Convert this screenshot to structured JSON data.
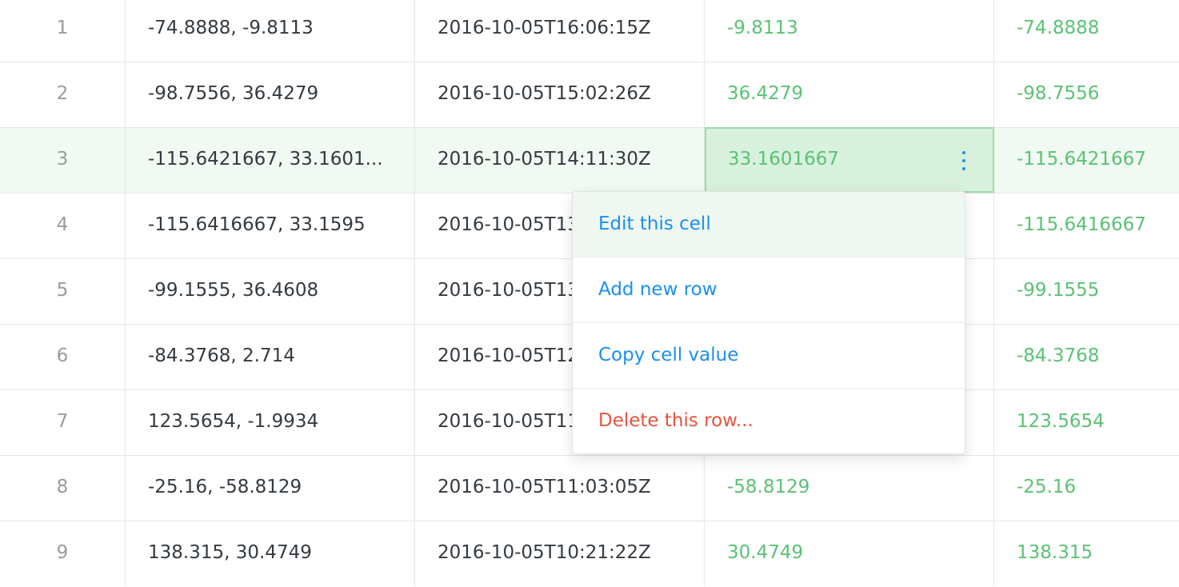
{
  "rows": [
    {
      "index": "1",
      "coord": "-74.8888, -9.8113",
      "time": "2016-10-05T16:06:15Z",
      "lat": "-9.8113",
      "lon": "-74.8888"
    },
    {
      "index": "2",
      "coord": "-98.7556, 36.4279",
      "time": "2016-10-05T15:02:26Z",
      "lat": "36.4279",
      "lon": "-98.7556"
    },
    {
      "index": "3",
      "coord": "-115.6421667, 33.1601...",
      "time": "2016-10-05T14:11:30Z",
      "lat": "33.1601667",
      "lon": "-115.6421667"
    },
    {
      "index": "4",
      "coord": "-115.6416667, 33.1595",
      "time": "2016-10-05T13",
      "lat": "",
      "lon": "-115.6416667"
    },
    {
      "index": "5",
      "coord": "-99.1555, 36.4608",
      "time": "2016-10-05T13",
      "lat": "",
      "lon": "-99.1555"
    },
    {
      "index": "6",
      "coord": "-84.3768, 2.714",
      "time": "2016-10-05T12",
      "lat": "",
      "lon": "-84.3768"
    },
    {
      "index": "7",
      "coord": "123.5654, -1.9934",
      "time": "2016-10-05T11",
      "lat": "",
      "lon": "123.5654"
    },
    {
      "index": "8",
      "coord": "-25.16, -58.8129",
      "time": "2016-10-05T11:03:05Z",
      "lat": "-58.8129",
      "lon": "-25.16"
    },
    {
      "index": "9",
      "coord": "138.315, 30.4749",
      "time": "2016-10-05T10:21:22Z",
      "lat": "30.4749",
      "lon": "138.315"
    }
  ],
  "context_menu": {
    "edit_label": "Edit this cell",
    "add_label": "Add new row",
    "copy_label": "Copy cell value",
    "delete_label": "Delete this row..."
  },
  "colors": {
    "accent": "#1d8ef0",
    "positive_text": "#5ac273",
    "danger": "#e8543f",
    "selected_row": "#f1f9f3",
    "active_cell": "#d8f1dd"
  },
  "icons": {
    "cell_menu": "kebab-vertical-icon"
  }
}
